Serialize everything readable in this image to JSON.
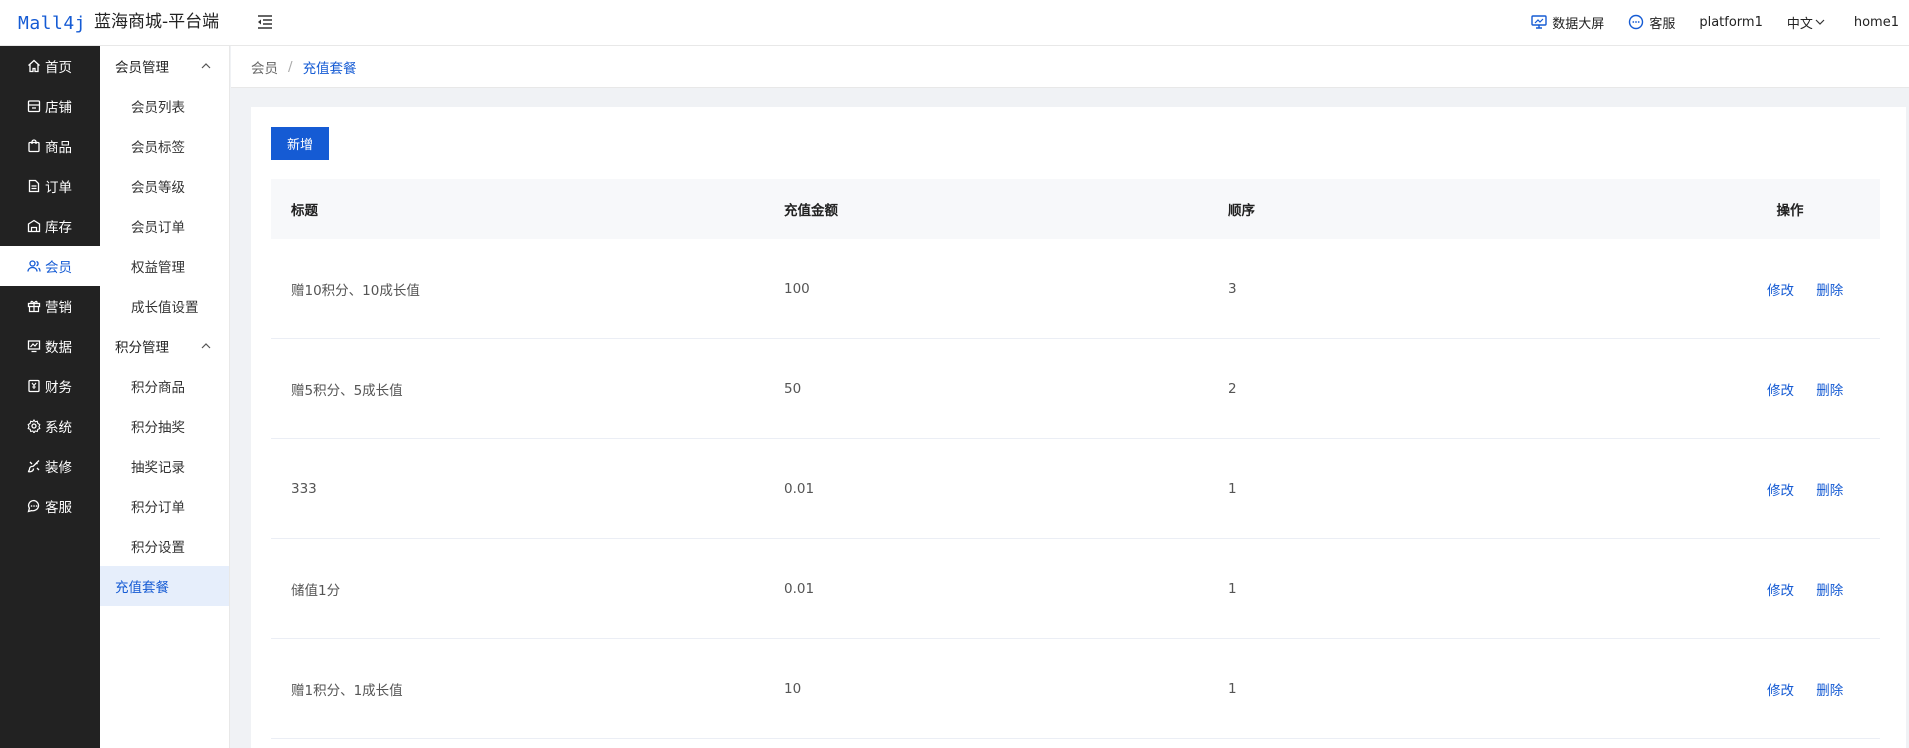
{
  "header": {
    "logo_text": "Mall4j",
    "app_title": "蓝海商城-平台端",
    "right": {
      "data_screen": "数据大屏",
      "service": "客服",
      "user": "platform1",
      "language": "中文",
      "home": "home1"
    }
  },
  "sidebar": {
    "items": [
      {
        "label": "首页",
        "icon": "home-icon"
      },
      {
        "label": "店铺",
        "icon": "store-icon"
      },
      {
        "label": "商品",
        "icon": "bag-icon"
      },
      {
        "label": "订单",
        "icon": "order-icon"
      },
      {
        "label": "库存",
        "icon": "warehouse-icon"
      },
      {
        "label": "会员",
        "icon": "user-icon"
      },
      {
        "label": "营销",
        "icon": "gift-icon"
      },
      {
        "label": "数据",
        "icon": "chart-icon"
      },
      {
        "label": "财务",
        "icon": "finance-icon"
      },
      {
        "label": "系统",
        "icon": "gear-icon"
      },
      {
        "label": "装修",
        "icon": "brush-icon"
      },
      {
        "label": "客服",
        "icon": "chat-icon"
      }
    ],
    "active_index": 5
  },
  "subsidebar": {
    "group1": "会员管理",
    "group1_items": [
      "会员列表",
      "会员标签",
      "会员等级",
      "会员订单",
      "权益管理",
      "成长值设置"
    ],
    "group2": "积分管理",
    "group2_items": [
      "积分商品",
      "积分抽奖",
      "抽奖记录",
      "积分订单",
      "积分设置"
    ],
    "top_item": "充值套餐"
  },
  "breadcrumb": {
    "parent": "会员",
    "separator": "/",
    "current": "充值套餐"
  },
  "toolbar": {
    "add_label": "新增"
  },
  "table": {
    "headers": {
      "title": "标题",
      "amount": "充值金额",
      "order": "顺序",
      "actions": "操作"
    },
    "edit_label": "修改",
    "delete_label": "删除",
    "rows": [
      {
        "title": "赠10积分、10成长值",
        "amount": "100",
        "order": "3"
      },
      {
        "title": "赠5积分、5成长值",
        "amount": "50",
        "order": "2"
      },
      {
        "title": "333",
        "amount": "0.01",
        "order": "1"
      },
      {
        "title": "储值1分",
        "amount": "0.01",
        "order": "1"
      },
      {
        "title": "赠1积分、1成长值",
        "amount": "10",
        "order": "1"
      }
    ]
  },
  "colors": {
    "accent": "#155bd4",
    "sidebar_bg": "#222222",
    "active_sub_bg": "#e6eefb"
  }
}
